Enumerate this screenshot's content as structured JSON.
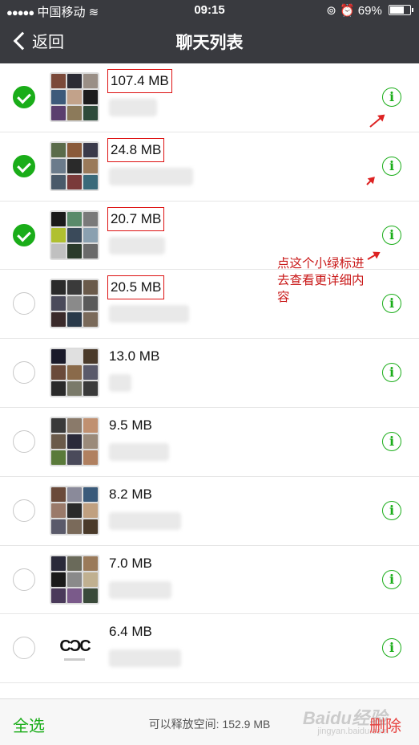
{
  "status_bar": {
    "carrier": "中国移动",
    "time": "09:15",
    "battery": "69%"
  },
  "nav": {
    "back_label": "返回",
    "title": "聊天列表"
  },
  "rows": [
    {
      "size": "107.4 MB",
      "checked": true,
      "highlighted": true,
      "avatar": "grid"
    },
    {
      "size": "24.8 MB",
      "checked": true,
      "highlighted": true,
      "avatar": "grid"
    },
    {
      "size": "20.7 MB",
      "checked": true,
      "highlighted": true,
      "avatar": "grid"
    },
    {
      "size": "20.5 MB",
      "checked": false,
      "highlighted": true,
      "avatar": "grid"
    },
    {
      "size": "13.0 MB",
      "checked": false,
      "highlighted": false,
      "avatar": "grid"
    },
    {
      "size": "9.5 MB",
      "checked": false,
      "highlighted": false,
      "avatar": "grid"
    },
    {
      "size": "8.2 MB",
      "checked": false,
      "highlighted": false,
      "avatar": "grid"
    },
    {
      "size": "7.0 MB",
      "checked": false,
      "highlighted": false,
      "avatar": "grid"
    },
    {
      "size": "6.4 MB",
      "checked": false,
      "highlighted": false,
      "avatar": "logo",
      "logo_text": "CϽC"
    }
  ],
  "info_icon_glyph": "i",
  "annotation": "点这个小绿标进去查看更详细内容",
  "bottom_bar": {
    "select_all": "全选",
    "free_space": "可以释放空间: 152.9 MB",
    "delete": "删除"
  },
  "watermark": {
    "text": "Baidu经验",
    "sub": "jingyan.baidu.com"
  },
  "colors": {
    "nav_background": "#393a3f",
    "accent_green": "#1aad19",
    "delete_red": "#e64340",
    "annotation_red": "#c91818"
  }
}
